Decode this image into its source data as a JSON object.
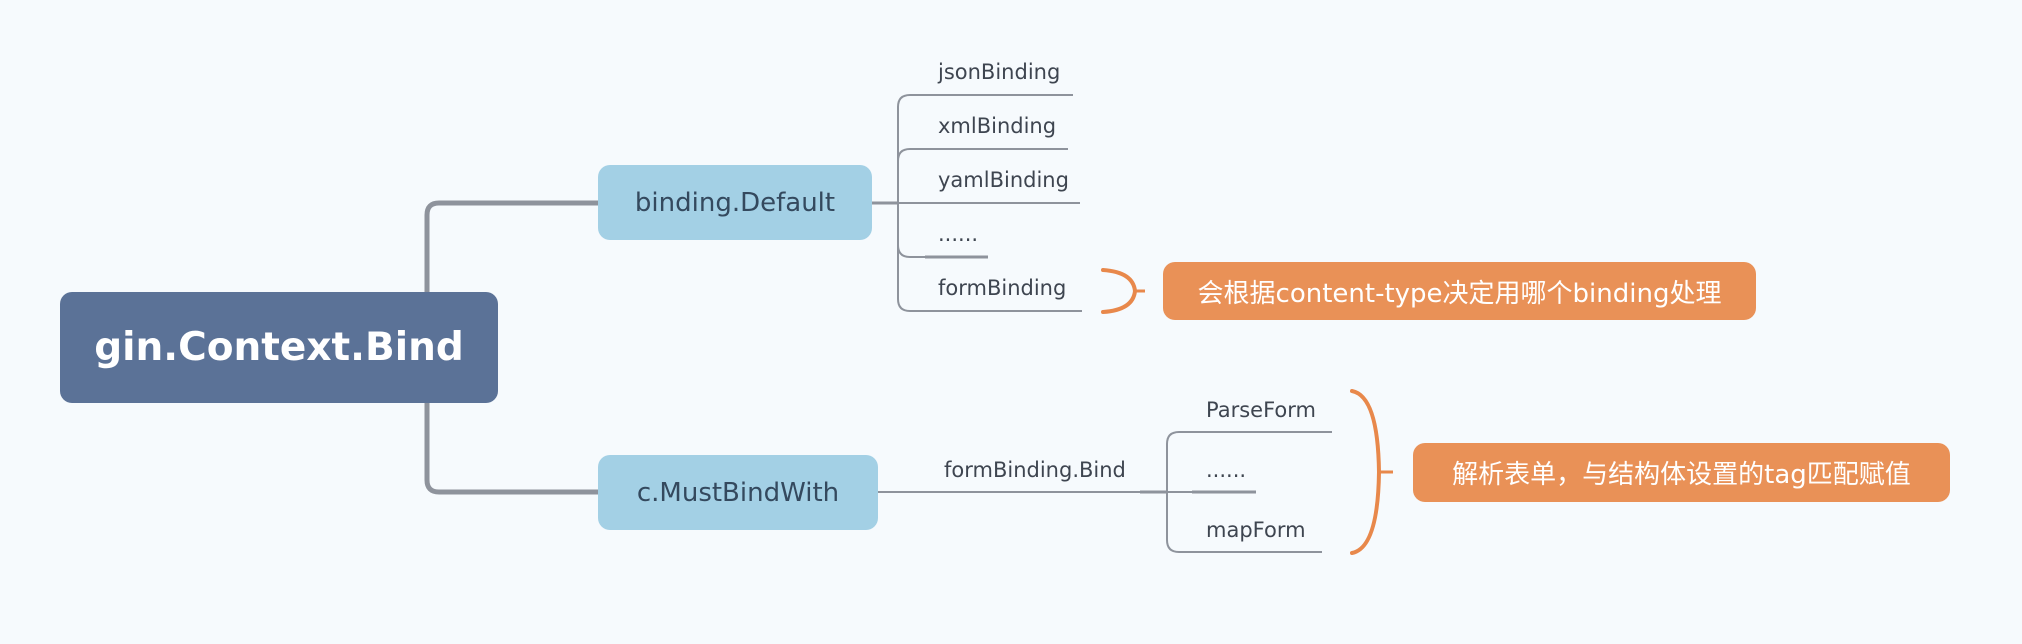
{
  "diagram": {
    "type": "mind-map",
    "colors": {
      "background": "#f6fafd",
      "root_fill": "#5b7297",
      "branch_fill": "#a3d0e5",
      "connector": "#8e939c",
      "callout_fill": "#e99157",
      "brace": "#e8884b"
    },
    "root": {
      "label": "gin.Context.Bind"
    },
    "branches": [
      {
        "label": "binding.Default",
        "children": [
          {
            "label": "jsonBinding"
          },
          {
            "label": "xmlBinding"
          },
          {
            "label": "yamlBinding"
          },
          {
            "label": "......"
          },
          {
            "label": "formBinding"
          }
        ],
        "summary": {
          "covers": [
            "formBinding"
          ],
          "label": "会根据content-type决定用哪个binding处理"
        }
      },
      {
        "label": "c.MustBindWith",
        "children": [
          {
            "label": "formBinding.Bind",
            "children": [
              {
                "label": "ParseForm"
              },
              {
                "label": "......"
              },
              {
                "label": "mapForm"
              }
            ]
          }
        ],
        "summary": {
          "covers": [
            "ParseForm",
            "......",
            "mapForm"
          ],
          "label": "解析表单，与结构体设置的tag匹配赋值"
        }
      }
    ]
  }
}
